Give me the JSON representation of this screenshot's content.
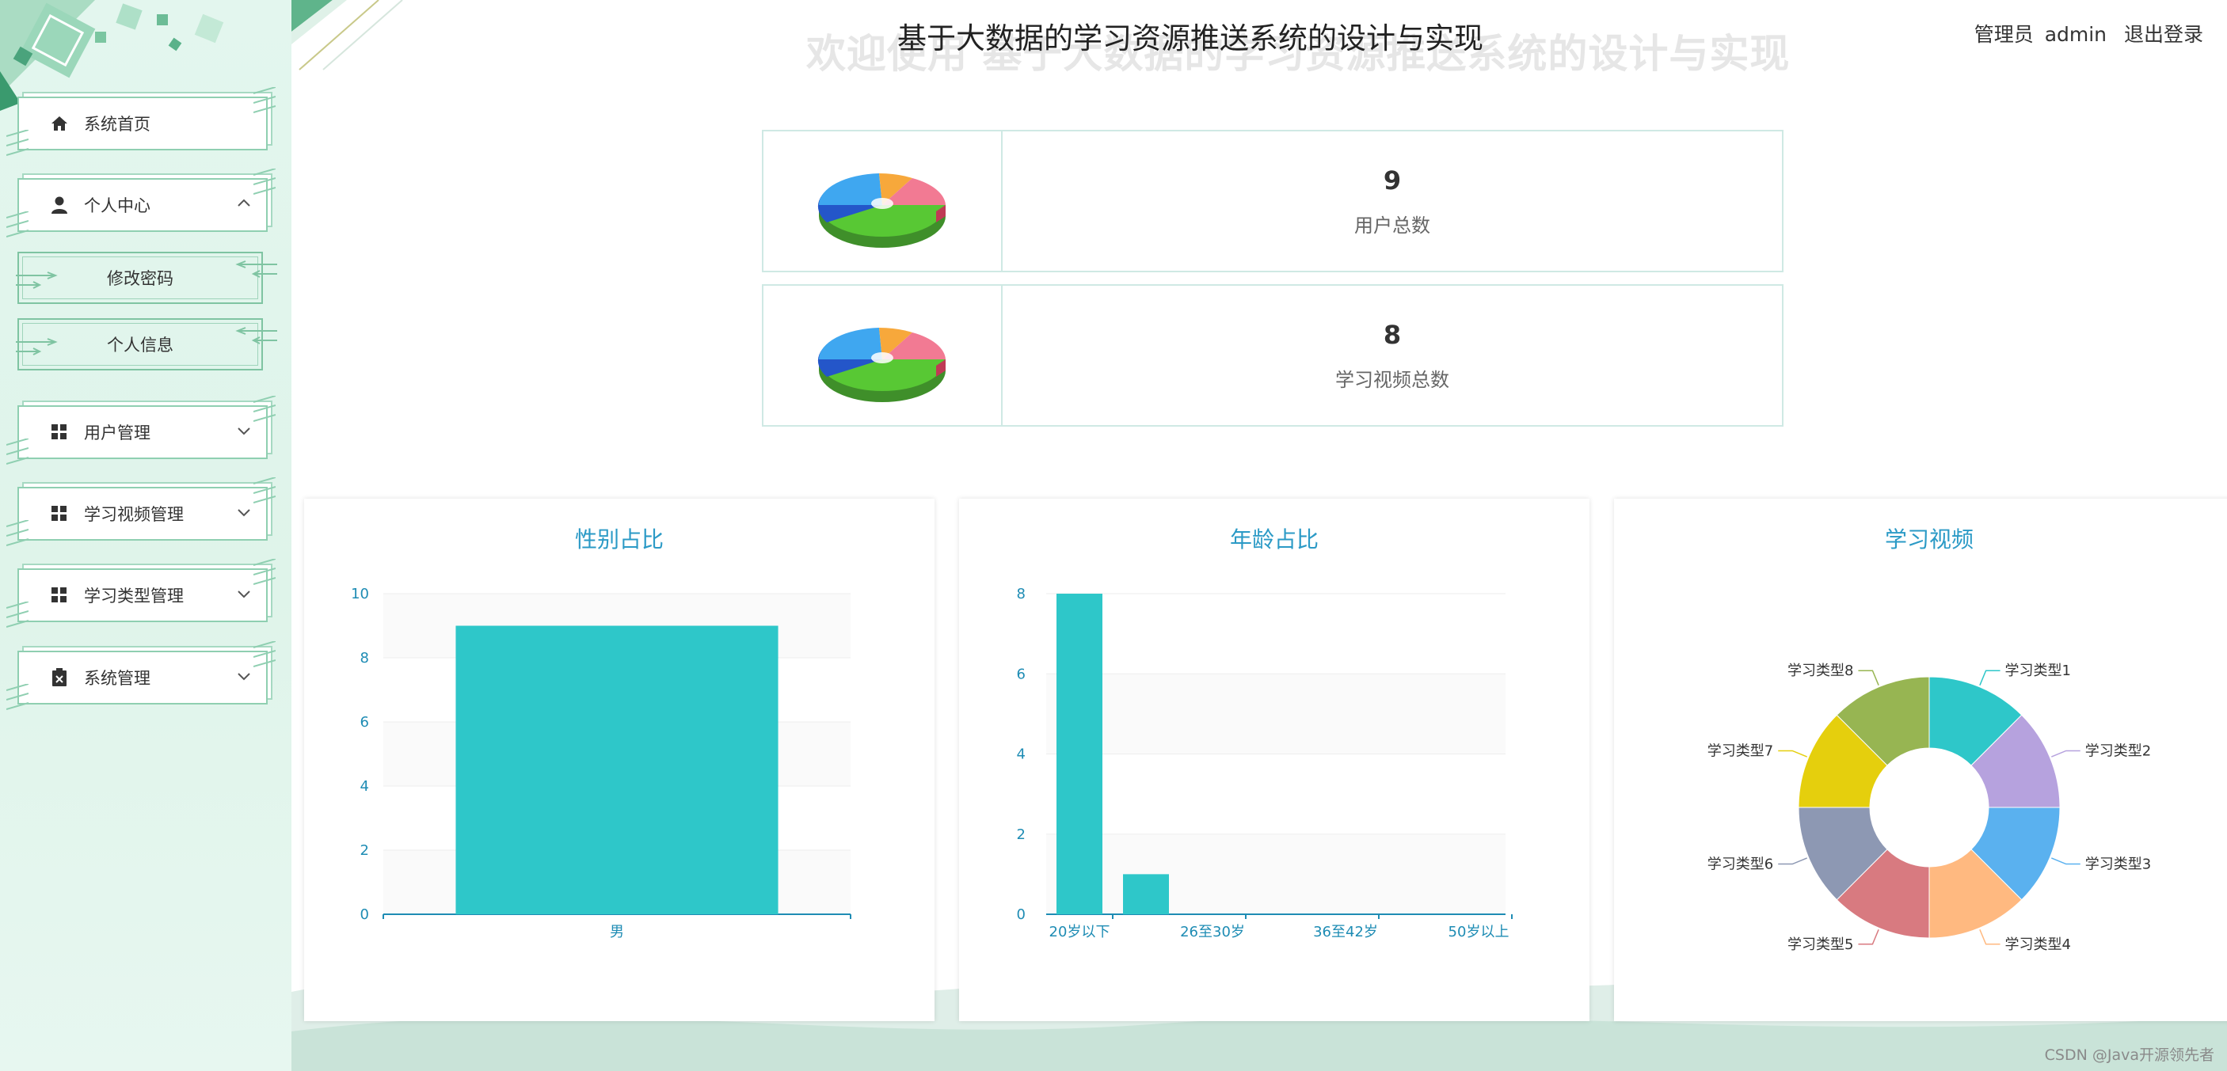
{
  "sidebar": {
    "items": [
      {
        "label": "系统首页",
        "icon": "home-icon"
      },
      {
        "label": "个人中心",
        "icon": "user-icon"
      },
      {
        "label": "用户管理",
        "icon": "grid-icon"
      },
      {
        "label": "学习视频管理",
        "icon": "grid-icon"
      },
      {
        "label": "学习类型管理",
        "icon": "grid-icon"
      },
      {
        "label": "系统管理",
        "icon": "clipboard-icon"
      }
    ],
    "subitems": [
      {
        "label": "修改密码"
      },
      {
        "label": "个人信息"
      }
    ]
  },
  "header": {
    "title": "基于大数据的学习资源推送系统的设计与实现",
    "welcome": "欢迎使用 基于大数据的学习资源推送系统的设计与实现",
    "role": "管理员",
    "username": "admin",
    "logout": "退出登录"
  },
  "stats": [
    {
      "value": "9",
      "label": "用户总数"
    },
    {
      "value": "8",
      "label": "学习视频总数"
    }
  ],
  "colors": {
    "bar": "#2ec7c9",
    "title": "#2b9ac6",
    "axis": "#1e8cb4",
    "pie": [
      "#2ec7c9",
      "#b6a2de",
      "#5ab1ef",
      "#ffb980",
      "#d87a80",
      "#8d98b3",
      "#e5cf0d",
      "#97b552"
    ]
  },
  "chart_data": [
    {
      "type": "bar",
      "title": "性别占比",
      "categories": [
        "男"
      ],
      "values": [
        9
      ],
      "ylim": [
        0,
        10
      ],
      "yticks": [
        0,
        2,
        4,
        6,
        8,
        10
      ],
      "grid": true
    },
    {
      "type": "bar",
      "title": "年龄占比",
      "categories": [
        "20岁以下",
        "",
        "26至30岁",
        "",
        "36至42岁",
        "",
        "50岁以上"
      ],
      "values": [
        8,
        1,
        0,
        0,
        0,
        0,
        0
      ],
      "ylim": [
        0,
        8
      ],
      "yticks": [
        0,
        2,
        4,
        6,
        8
      ],
      "grid": true
    },
    {
      "type": "pie",
      "title": "学习视频",
      "categories": [
        "学习类型1",
        "学习类型2",
        "学习类型3",
        "学习类型4",
        "学习类型5",
        "学习类型6",
        "学习类型7",
        "学习类型8"
      ],
      "values": [
        1,
        1,
        1,
        1,
        1,
        1,
        1,
        1
      ]
    }
  ],
  "watermark": "CSDN @Java开源领先者"
}
